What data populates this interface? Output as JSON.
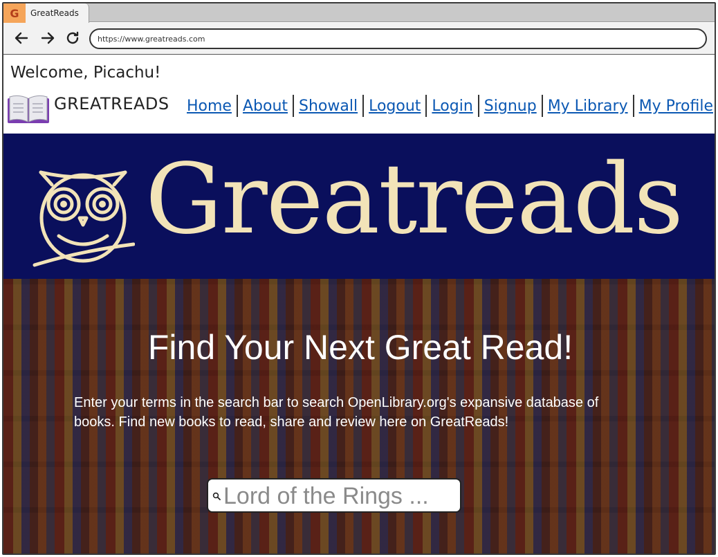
{
  "browser": {
    "tab_title": "GreatReads",
    "favicon_letter": "G",
    "url": "https://www.greatreads.com"
  },
  "header": {
    "welcome": "Welcome, Picachu!",
    "brand": "GREATREADS",
    "logo_icon": "open-book-icon",
    "nav": [
      "Home",
      "About",
      "Showall",
      "Logout",
      "Login",
      "Signup",
      "My Library",
      "My Profile"
    ]
  },
  "banner": {
    "title": "Greatreads",
    "logo": "owl-icon",
    "bg_color": "#0a0f5c",
    "text_color": "#f2e3b8"
  },
  "hero": {
    "title": "Find Your Next Great Read!",
    "description": "Enter your terms in the search bar to search OpenLibrary.org's expansive database of books.  Find new books to read, share and review here on GreatReads!",
    "search_placeholder": "Lord of the Rings ..."
  },
  "colors": {
    "link": "#0b58b3",
    "favicon_bg": "#f5a55a"
  }
}
